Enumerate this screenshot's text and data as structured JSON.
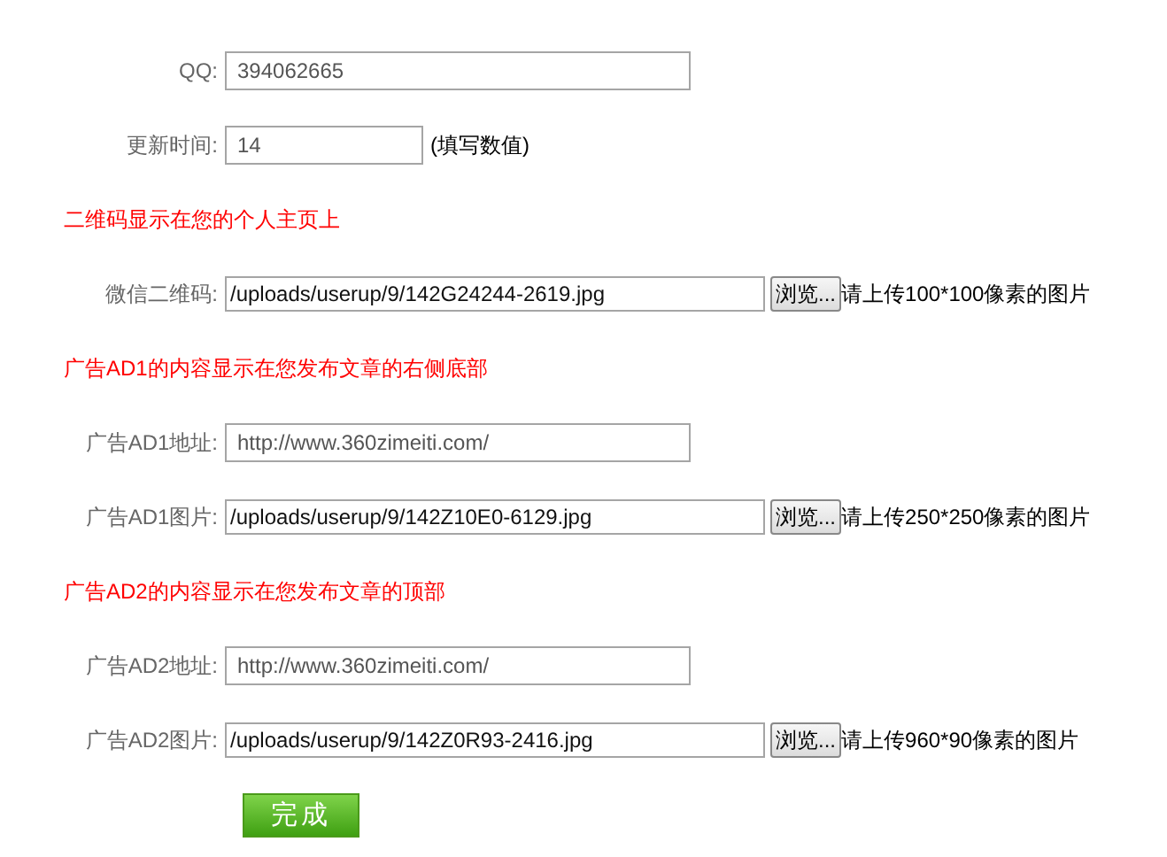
{
  "rows": [
    {
      "kind": "text",
      "label": "QQ:",
      "value": "394062665"
    },
    {
      "kind": "number",
      "label": "更新时间:",
      "value": "14",
      "note": "(填写数值)"
    },
    {
      "kind": "heading",
      "text": "二维码显示在您的个人主页上"
    },
    {
      "kind": "file",
      "label": "微信二维码:",
      "value": "/uploads/userup/9/142G24244-2619.jpg",
      "button": "浏览...",
      "hint": "请上传100*100像素的图片"
    },
    {
      "kind": "heading",
      "text": "广告AD1的内容显示在您发布文章的右侧底部"
    },
    {
      "kind": "text",
      "label": "广告AD1地址:",
      "value": "http://www.360zimeiti.com/"
    },
    {
      "kind": "file",
      "label": "广告AD1图片:",
      "value": "/uploads/userup/9/142Z10E0-6129.jpg",
      "button": "浏览...",
      "hint": "请上传250*250像素的图片"
    },
    {
      "kind": "heading",
      "text": "广告AD2的内容显示在您发布文章的顶部"
    },
    {
      "kind": "text",
      "label": "广告AD2地址:",
      "value": "http://www.360zimeiti.com/"
    },
    {
      "kind": "file",
      "label": "广告AD2图片:",
      "value": "/uploads/userup/9/142Z0R93-2416.jpg",
      "button": "浏览...",
      "hint": "请上传960*90像素的图片"
    }
  ],
  "submit": "完成"
}
